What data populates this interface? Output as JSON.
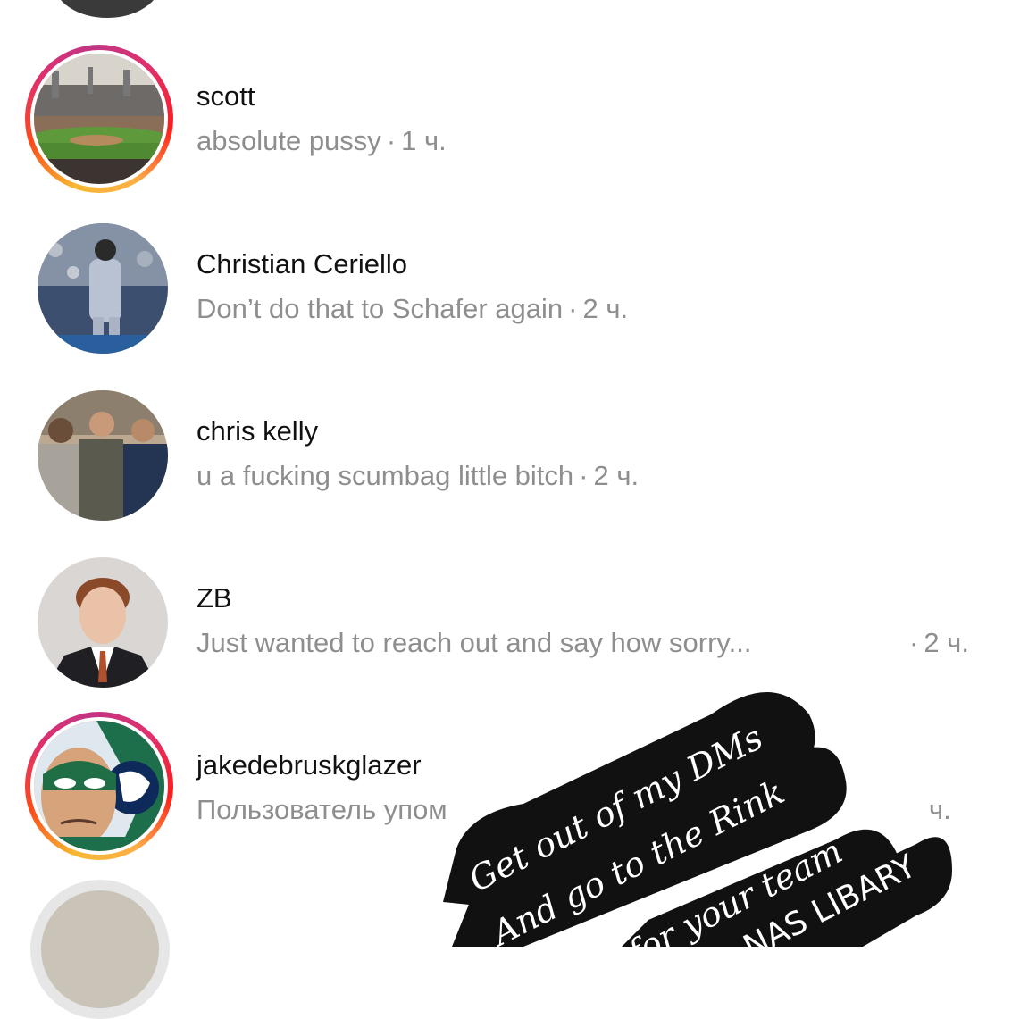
{
  "rows": [
    {
      "name": "scott",
      "message": "absolute pussy",
      "time": "1 ч."
    },
    {
      "name": "Christian Ceriello",
      "message": "Don’t do that to Schafer again",
      "time": "2 ч."
    },
    {
      "name": "chris kelly",
      "message": "u a fucking scumbag little bitch",
      "time": "2 ч."
    },
    {
      "name": "ZB",
      "message": "Just wanted to reach out and say how sorry...",
      "time": "2 ч."
    },
    {
      "name": "jakedebruskglazer",
      "message": "Пользователь упом",
      "time": "ч."
    }
  ],
  "sticker": {
    "line1": "Get out of my DMs",
    "line2": "And go to the Rink",
    "line3": "for your team",
    "line4": "NAS LIBARY"
  },
  "colors": {
    "primary_text": "#111111",
    "secondary_text": "#8e8e8e",
    "story_ring": "#e1306c",
    "sticker_bg": "#111111"
  }
}
